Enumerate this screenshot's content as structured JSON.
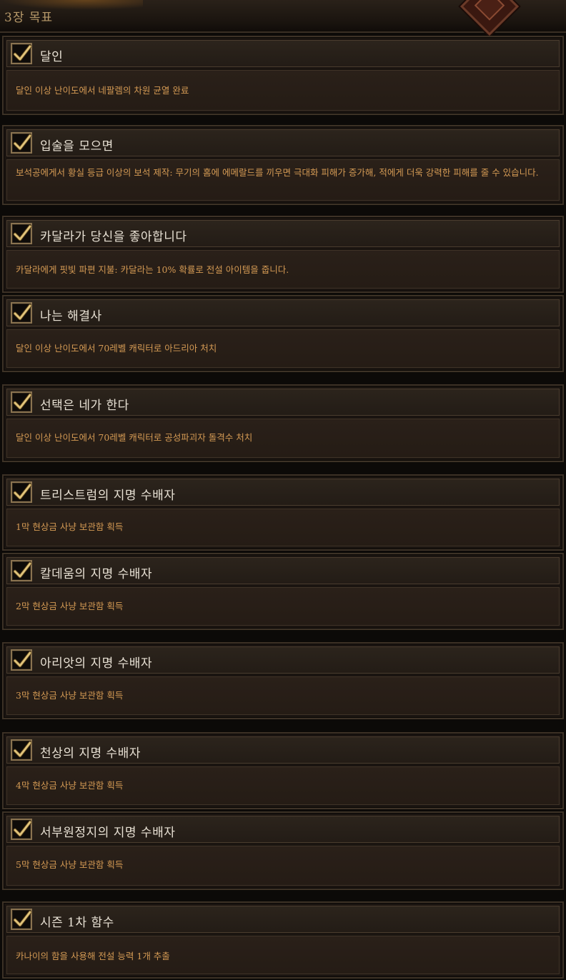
{
  "header": {
    "title": "3장 목표"
  },
  "objectives": [
    {
      "title": "달인",
      "description": "달인 이상 난이도에서 네팔렘의 차원 균열 완료",
      "completed": true
    },
    {
      "title": "입술을 모으면",
      "description": "보석공에게서 황실 등급 이상의 보석 제작: 무기의 홈에 에메랄드를 끼우면 극대화 피해가 증가해, 적에게 더욱 강력한 피해를 줄 수 있습니다.",
      "completed": true
    },
    {
      "title": "카달라가 당신을 좋아합니다",
      "description": "카달라에게 핏빛 파편 지불: 카달라는 10% 확률로 전설 아이템을 줍니다.",
      "completed": true
    },
    {
      "title": "나는 해결사",
      "description": "달인 이상 난이도에서 70레벨 캐릭터로 아드리아 처치",
      "completed": true
    },
    {
      "title": "선택은 네가 한다",
      "description": "달인 이상 난이도에서 70레벨 캐릭터로 공성파괴자 돌격수 처치",
      "completed": true
    },
    {
      "title": "트리스트럼의 지명 수배자",
      "description": "1막 현상금 사냥 보관함 획득",
      "completed": true
    },
    {
      "title": "칼데움의 지명 수배자",
      "description": "2막 현상금 사냥 보관함 획득",
      "completed": true
    },
    {
      "title": "아리앗의 지명 수배자",
      "description": "3막 현상금 사냥 보관함 획득",
      "completed": true
    },
    {
      "title": "천상의 지명 수배자",
      "description": "4막 현상금 사냥 보관함 획득",
      "completed": true
    },
    {
      "title": "서부원정지의 지명 수배자",
      "description": "5막 현상금 사냥 보관함 획득",
      "completed": true
    },
    {
      "title": "시즌 1차 함수",
      "description": "카나이의 함을 사용해 전설 능력 1개 추출",
      "completed": true
    }
  ],
  "icons": {
    "checkbox": "checkmark-icon",
    "emblem": "emblem-icon"
  },
  "colors": {
    "title": "#e8e1d4",
    "description": "#d49a54",
    "header": "#b89a6a",
    "checkmark": "#e0c37a"
  }
}
